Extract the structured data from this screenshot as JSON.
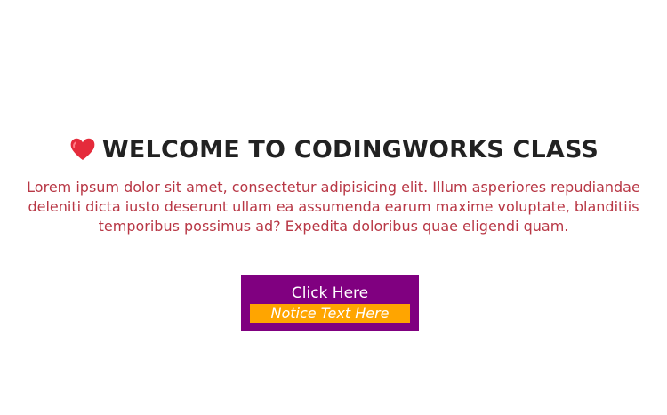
{
  "hero": {
    "icon": "heart-icon",
    "title": "WELCOME TO CODINGWORKS CLASS",
    "description": "Lorem ipsum dolor sit amet, consectetur adipisicing elit. Illum asperiores repudiandae deleniti dicta iusto deserunt ullam ea assumenda earum maxime voluptate, blanditiis temporibus possimus ad? Expedita doloribus quae eligendi quam."
  },
  "cta": {
    "label": "Click Here",
    "notice": "Notice Text Here"
  },
  "colors": {
    "title": "#222222",
    "description": "#b83745",
    "button_bg": "#800080",
    "notice_bg": "#ffa500",
    "heart": "#e52b3b"
  }
}
